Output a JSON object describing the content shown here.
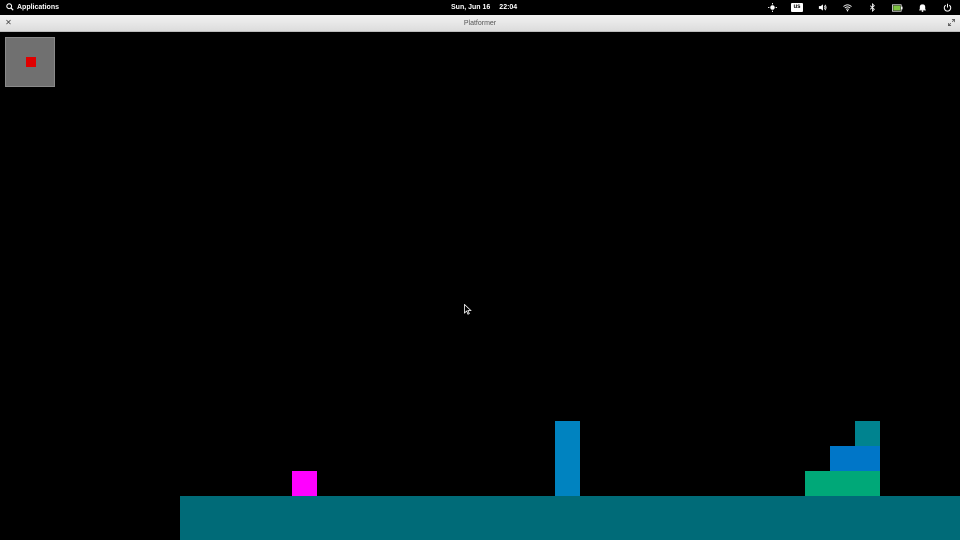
{
  "panel": {
    "apps_label": "Applications",
    "date": "Sun, Jun 16",
    "time": "22:04",
    "keyboard_layout": "us",
    "icons": [
      "night-light-icon",
      "keyboard-layout-indicator",
      "volume-icon",
      "wifi-icon",
      "bluetooth-icon",
      "battery-icon",
      "notification-bell-icon",
      "power-icon"
    ],
    "battery_color": "#7ec242"
  },
  "window": {
    "title": "Platformer"
  },
  "game": {
    "background": "#000000",
    "colors": {
      "ground": "#006b78",
      "player": "#ff00ff",
      "pillar": "#0083c0",
      "stair_low": "#00a878",
      "stair_mid": "#0076c8",
      "stair_top": "#00838f",
      "minimap_bg": "#707070",
      "minimap_marker": "#e00000"
    }
  }
}
